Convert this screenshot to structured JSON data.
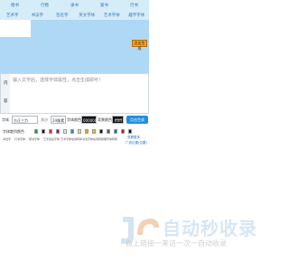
{
  "nav": {
    "row1": [
      "楷书",
      "行楷",
      "隶书",
      "篆书",
      "行书"
    ],
    "row2": [
      "艺术字",
      "书法字",
      "签名字",
      "英文字体",
      "艺术字体",
      "趣字字体"
    ]
  },
  "banner": {
    "button_label": "点击生成"
  },
  "input": {
    "side_label_top": "内",
    "side_label_bottom": "容",
    "placeholder": "输入文字后，选择字体属性，点击生成即可！"
  },
  "controls": {
    "font_label": "字体",
    "font_value": "方正三力",
    "size_label": "大小",
    "size_value": "24像素",
    "color_label": "字体颜色",
    "color_value": "000000",
    "bg_label": "背景颜色",
    "bg_value": "ffffff",
    "generate_label": "点击生成"
  },
  "colorbar": {
    "label": "字体散列颜色",
    "swatches": [
      "#1f9d2f",
      "#111111",
      "#d7281c",
      "#6a1a90",
      "#e8e8e8",
      "#1f8fe0",
      "#e0d7a6",
      "#f2a214",
      "#e7c01d",
      "#0f0f0f",
      "#5a5a5a",
      "#1a6fc4",
      "#b81414",
      "#111111"
    ]
  },
  "styles": [
    "书法字",
    "行书字体",
    "楷书字体",
    "艺术签名字体",
    "艺术字体在线转换",
    "书法字体在线转换器",
    "字体转换"
  ],
  "more": {
    "line1": "查看更多",
    "line2": "广告位置(位置)"
  },
  "watermark": {
    "title": "自动秒收录",
    "subtitle": "做上链接一来访一次一自动收录"
  }
}
